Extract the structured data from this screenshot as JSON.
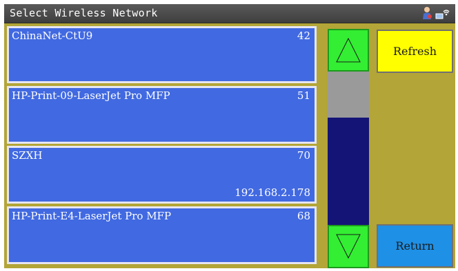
{
  "titlebar": {
    "title": "Select Wireless Network",
    "icons": [
      "user-icon",
      "wifi-signal-icon"
    ]
  },
  "networks": [
    {
      "ssid": "ChinaNet-CtU9",
      "signal": "42",
      "ip": ""
    },
    {
      "ssid": "HP-Print-09-LaserJet Pro MFP",
      "signal": "51",
      "ip": ""
    },
    {
      "ssid": "SZXH",
      "signal": "70",
      "ip": "192.168.2.178"
    },
    {
      "ssid": "HP-Print-E4-LaserJet Pro MFP",
      "signal": "68",
      "ip": ""
    }
  ],
  "scrollbar": {
    "up_icon": "triangle-up-icon",
    "down_icon": "triangle-down-icon",
    "thumb_position": 0.0,
    "thumb_fraction": 0.3
  },
  "buttons": {
    "refresh_label": "Refresh",
    "return_label": "Return"
  },
  "colors": {
    "background": "#b3a537",
    "item": "#4169e1",
    "scroll_button": "#33ee33",
    "scroll_track": "#141477",
    "scroll_thumb": "#9a9a9a",
    "refresh": "#ffff00",
    "return": "#1e90e6"
  }
}
